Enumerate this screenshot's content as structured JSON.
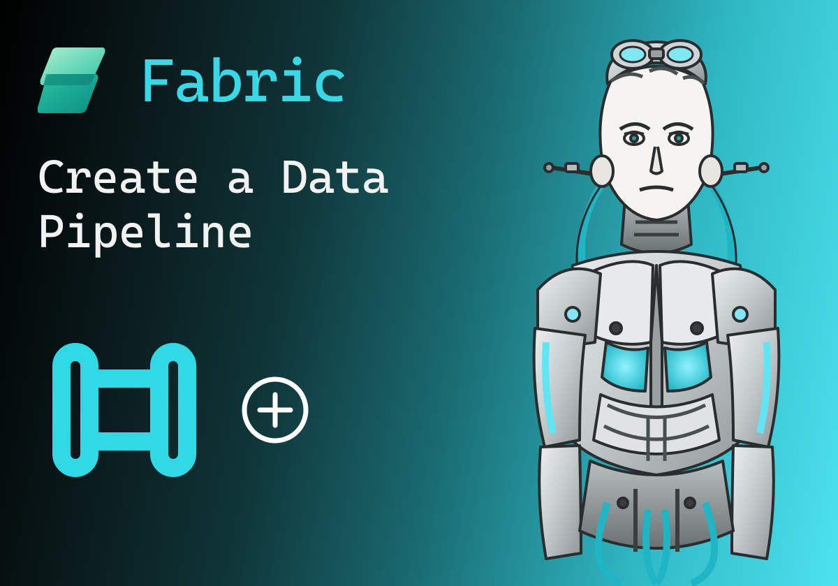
{
  "brand": {
    "name": "Fabric",
    "logo_colors": {
      "top": "#8fe7c6",
      "mid": "#2bc3a3",
      "bottom": "#0a9b8b"
    }
  },
  "headline": "Create a Data\nPipeline",
  "icons": {
    "pipeline": {
      "name": "pipeline-icon",
      "stroke": "#2fd9e6"
    },
    "add": {
      "name": "plus-circle-icon",
      "stroke": "#ffffff"
    }
  },
  "illustration": {
    "name": "cyborg-figure",
    "palette": {
      "skin": "#f5f4f0",
      "metal_light": "#d6dadc",
      "metal_mid": "#a7adb0",
      "metal_dark": "#616769",
      "accent": "#2fd9e6",
      "outline": "#2a2d2e"
    }
  }
}
